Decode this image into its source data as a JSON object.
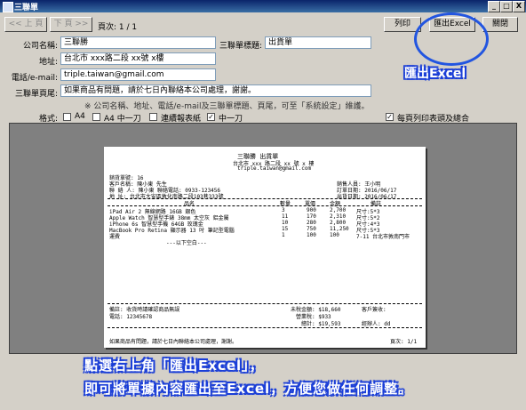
{
  "window": {
    "title": "三聯單",
    "min_label": "_",
    "max_label": "□",
    "close_label": "X"
  },
  "toolbar": {
    "prev_label": "<< 上 頁",
    "next_label": "下 頁 >>",
    "page_indicator": "頁次: 1 / 1",
    "print_label": "列印",
    "export_label": "匯出Excel",
    "close_label": "關閉"
  },
  "form": {
    "company_label": "公司名稱:",
    "company_value": "三聯勝",
    "title_label": "三聯單標題:",
    "title_value": "出貨單",
    "address_label": "地址:",
    "address_value": "台北市 xxx路二段 xx號 x樓",
    "contact_label": "電話/e-mail:",
    "contact_value": "triple.taiwan@gmail.com",
    "footer_label": "三聯單頁尾:",
    "footer_value": "如果商品有問題，請於七日內聯絡本公司處理，謝謝。",
    "note": "※ 公司名稱、地址、電話/e-mail及三聯單標題、頁尾，可至「系統設定」維護。"
  },
  "format": {
    "label": "格式:",
    "options": [
      {
        "label": "A4",
        "checked": false
      },
      {
        "label": "A4 中一刀",
        "checked": false
      },
      {
        "label": "連續報表紙",
        "checked": false
      },
      {
        "label": "中一刀",
        "checked": true
      }
    ],
    "per_page_header_label": "每頁列印表頭及總合",
    "per_page_header_checked": true
  },
  "preview": {
    "company": "三聯勝 出貨單",
    "address": "台北市 xxx 路二段 xx 號 x 樓",
    "email": "triple.taiwan@gmail.com",
    "order_no": "銷貨單號: 16",
    "customer": "客戶名稱: 陳小東 先生",
    "contact": "聯 絡 人: 陳小東    聯絡電話: 0933-123456",
    "ship_addr": "地    址: 台北市大安區敦化南路二段103巷333號",
    "sales": "銷售人員: 王小明",
    "order_date": "訂單日期: 2016/06/17",
    "ship_date": "出貨日期: 2016/06/17",
    "columns": [
      "品名",
      "數量",
      "單價",
      "金額",
      "備註"
    ],
    "rows": [
      [
        "iPad Air 2 無線網路 16GB 銀色",
        "3",
        "900",
        "2,700",
        "尺寸:5*3"
      ],
      [
        "Apple Watch 智慧型手錶 38mm 太空灰 鋁金屬",
        "11",
        "170",
        "2,310",
        "尺寸:5*2"
      ],
      [
        "iPhone 6s 智慧型手機 64GB 玫瑰金",
        "10",
        "280",
        "2,800",
        "尺寸:4*3"
      ],
      [
        "MacBook Pro Retina 顯示器 13 吋 筆記型電腦",
        "15",
        "750",
        "11,250",
        "尺寸:5*3"
      ],
      [
        "運費",
        "1",
        "100",
        "100",
        "7-11 台北市敦南門市"
      ]
    ],
    "below_rows": "---以下空白---",
    "account_info": "備註: 收貨時請確認商品無誤",
    "phone": "電話: 12345678",
    "subtotal": "未稅金額: $18,660",
    "tax": "營業稅: $933",
    "total": "總計: $19,593",
    "customer_sign": "客戶簽收:",
    "handler": "經辦人: dd",
    "footer": "如果商品有問題，請於七日內聯絡本公司處理，謝謝。",
    "page": "頁次: 1/1"
  },
  "annotations": {
    "callout": "匯出Excel",
    "banner_line1": "點選右上角「匯出Excel」，",
    "banner_line2": "即可將單據內容匯出至Excel，方便您做任何調整。"
  }
}
